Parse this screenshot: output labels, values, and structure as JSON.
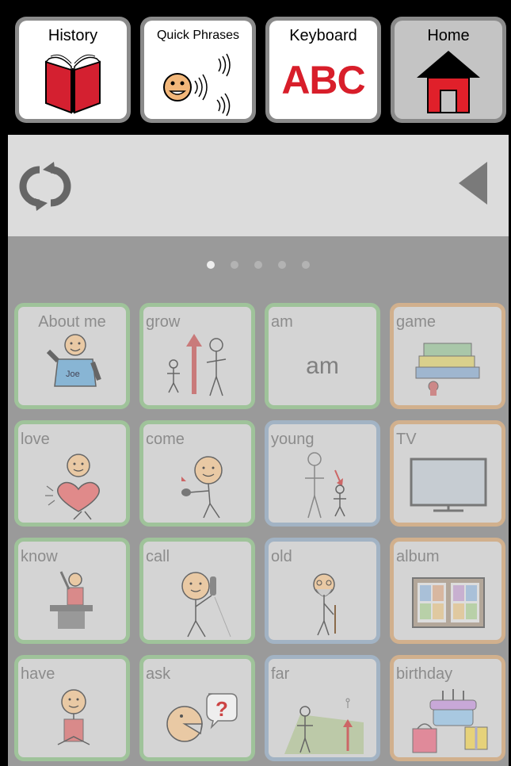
{
  "toolbar": {
    "history_label": "History",
    "quick_phrases_label": "Quick Phrases",
    "keyboard_label": "Keyboard",
    "keyboard_icon_text": "ABC",
    "home_label": "Home"
  },
  "message_bar": {
    "refresh_icon": "refresh-icon",
    "back_icon": "triangle-left-icon"
  },
  "pager": {
    "pages": 5,
    "current": 1
  },
  "grid": {
    "tiles": [
      {
        "label": "About me",
        "category": "green",
        "icon": "person-shirt-icon",
        "shirt_text": "Joe"
      },
      {
        "label": "grow",
        "category": "green",
        "icon": "grow-icon"
      },
      {
        "label": "am",
        "category": "green",
        "icon": "am-text",
        "symbol_text": "am"
      },
      {
        "label": "game",
        "category": "orange",
        "icon": "board-games-icon"
      },
      {
        "label": "love",
        "category": "green",
        "icon": "heart-person-icon"
      },
      {
        "label": "come",
        "category": "green",
        "icon": "beckon-person-icon"
      },
      {
        "label": "young",
        "category": "blue",
        "icon": "young-icon"
      },
      {
        "label": "TV",
        "category": "orange",
        "icon": "tv-icon"
      },
      {
        "label": "know",
        "category": "green",
        "icon": "raised-hand-desk-icon"
      },
      {
        "label": "call",
        "category": "green",
        "icon": "phone-person-icon"
      },
      {
        "label": "old",
        "category": "blue",
        "icon": "old-man-icon"
      },
      {
        "label": "album",
        "category": "orange",
        "icon": "photo-album-icon"
      },
      {
        "label": "have",
        "category": "green",
        "icon": "holding-person-icon"
      },
      {
        "label": "ask",
        "category": "green",
        "icon": "question-face-icon"
      },
      {
        "label": "far",
        "category": "blue",
        "icon": "far-icon"
      },
      {
        "label": "birthday",
        "category": "orange",
        "icon": "birthday-cake-icon"
      }
    ]
  },
  "colors": {
    "green_border": "#9fc39a",
    "blue_border": "#a2b3c4",
    "orange_border": "#d1b08d",
    "book_red": "#d42030",
    "keyboard_red": "#d81e2a",
    "home_red": "#e0202a"
  }
}
